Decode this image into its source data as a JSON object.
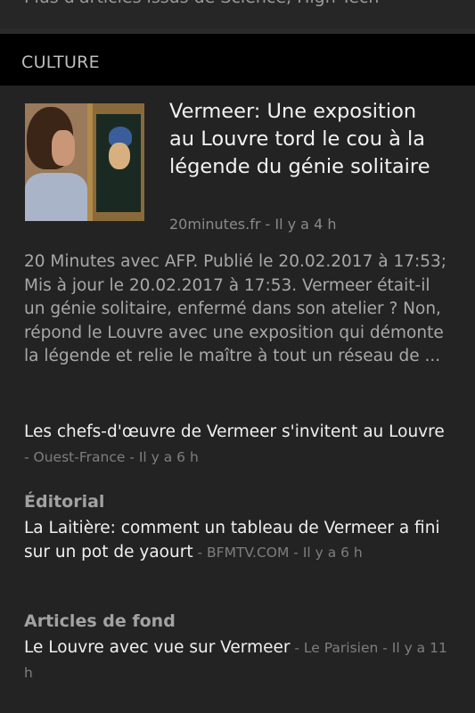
{
  "top_cut_text": "Plus d'articles issus de Science, High Tech",
  "section": {
    "title": "CULTURE"
  },
  "main_story": {
    "headline": "Vermeer: Une exposition au Louvre tord le cou à la légende du génie solitaire",
    "source": "20minutes.fr",
    "time": "Il y a 4 h",
    "summary": "20 Minutes avec AFP. Publié le 20.02.2017 à 17:53; Mis à jour le 20.02.2017 à 17:53. Vermeer était-il un génie solitaire, enfermé dans son atelier ? Non, répond le Louvre avec une exposition qui démonte la légende et relie le maître à tout un réseau de ..."
  },
  "related": [
    {
      "label": "",
      "title": "Les chefs-d'œuvre de Vermeer s'invitent au Louvre",
      "source": "Ouest-France",
      "time": "Il y a 6 h"
    },
    {
      "label": "Éditorial",
      "title": "La Laitière: comment un tableau de Vermeer a fini sur un pot de yaourt",
      "source": "BFMTV.COM",
      "time": "Il y a 6 h"
    },
    {
      "label": "Articles de fond",
      "title": "Le Louvre avec vue sur Vermeer",
      "source": "Le Parisien",
      "time": "Il y a 11 h"
    }
  ],
  "separator": " - "
}
